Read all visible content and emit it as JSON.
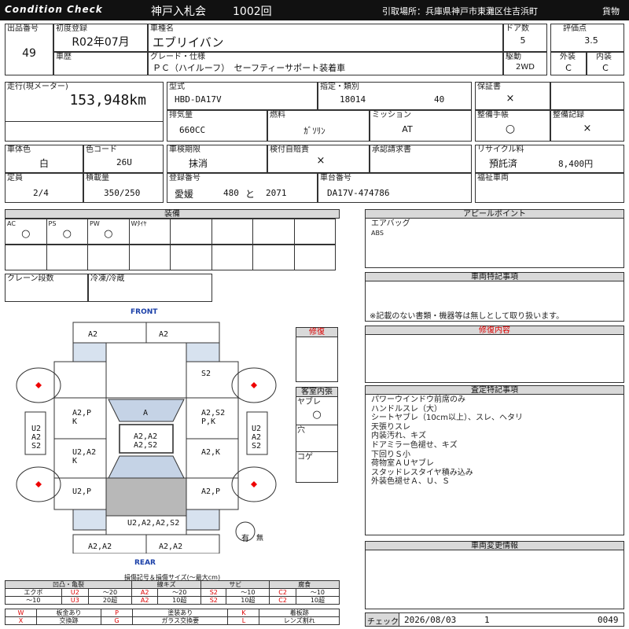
{
  "header": {
    "left_title": "Condition Check",
    "auction": "神戸入札会",
    "lot_round": "1002回",
    "pickup": "引取場所：兵庫県神戸市東灘区住吉浜町",
    "category": "貨物"
  },
  "row1": {
    "lot_label": "出品番号",
    "lot_value": "49",
    "first_reg_label": "初度登録",
    "first_reg_value": "R02年07月",
    "car_name_label": "車種名",
    "car_name_value": "エブリイバン",
    "doors_label": "ドア数",
    "doors_value": "5",
    "score_label": "評価点",
    "score_value": "3.5",
    "history_label": "車歴",
    "grade_label": "グレード・仕様",
    "grade_value": "ＰＣ（ハイルーフ）　セーフティーサポート装着車",
    "drive_label": "駆動",
    "drive_value": "2WD",
    "ext_label": "外装",
    "ext_value": "C",
    "int_label": "内装",
    "int_value": "C"
  },
  "row2": {
    "mileage_label": "走行(現メーター)",
    "mileage_value": "153,948km",
    "model_label": "型式",
    "model_value": "HBD-DA17V",
    "designation_label": "指定・類別",
    "designation_value": "18014",
    "class_value": "40",
    "warranty_label": "保証書",
    "warranty_value": "×",
    "disp_label": "排気量",
    "disp_value": "660CC",
    "fuel_label": "燃料",
    "fuel_value": "ｶﾞｿﾘﾝ",
    "mission_label": "ミッション",
    "mission_value": "AT",
    "manual_label": "整備手帳",
    "manual_value": "○",
    "record_label": "整備記録",
    "record_value": "×"
  },
  "row3": {
    "color_label": "車体色",
    "color_value": "白",
    "colorcode_label": "色コード",
    "colorcode_value": "26U",
    "inspection_label": "車検期限",
    "inspection_value": "抹消",
    "selfcheck_label": "検付自賠責",
    "selfcheck_value": "×",
    "approval_label": "承認請求書",
    "recycle_label": "リサイクル料",
    "recycle_status": "預託済",
    "recycle_value": "8,400円",
    "capacity_label": "定員",
    "capacity_value": "2/4",
    "load_label": "積載量",
    "load_value": "350/250",
    "plate_label": "登録番号",
    "plate_pref": "愛媛",
    "plate_class": "480",
    "plate_kana": "と",
    "plate_num": "2071",
    "chassis_label": "車台番号",
    "chassis_value": "DA17V-474786",
    "welfare_label": "福祉車両"
  },
  "equipment": {
    "title": "装備",
    "cells": [
      {
        "label": "AC",
        "mark": "○"
      },
      {
        "label": "PS",
        "mark": "○"
      },
      {
        "label": "PW",
        "mark": "○"
      },
      {
        "label": "Wﾀｲﾔ",
        "mark": ""
      },
      {
        "label": "",
        "mark": ""
      },
      {
        "label": "",
        "mark": ""
      },
      {
        "label": "",
        "mark": ""
      },
      {
        "label": "",
        "mark": ""
      }
    ],
    "crane_label": "クレーン段数",
    "freezer_label": "冷凍/冷蔵"
  },
  "appeal": {
    "title": "アピールポイント",
    "line1": "エアバッグ",
    "line2": "ABS"
  },
  "special": {
    "title": "車両特記事項",
    "note": "※記載のない書類・機器等は無しとして取り扱います。"
  },
  "repair": {
    "title": "修復内容",
    "side_label": "修復"
  },
  "interior": {
    "title": "客室内張",
    "items": [
      {
        "label": "ヤブレ",
        "mark": "○"
      },
      {
        "label": "穴",
        "mark": ""
      },
      {
        "label": "コゲ",
        "mark": ""
      }
    ]
  },
  "inspection_notes": {
    "title": "査定特記事項",
    "lines": [
      "パワーウインドウ前席のみ",
      "ハンドルスレ（大）",
      "シートヤブレ（10cm以上）、スレ、ヘタリ",
      "天張りスレ",
      "内装汚れ、キズ",
      "ドアミラー色褪せ、キズ",
      "下回りＳ小",
      "荷物室ＡＵヤブレ",
      "スタッドレスタイヤ積み込み",
      "外装色褪せＡ、Ｕ、Ｓ"
    ]
  },
  "change_info": {
    "title": "車両変更情報"
  },
  "diagram": {
    "front": "FRONT",
    "rear": "REAR",
    "front_bumper_left": "A2",
    "front_bumper_right": "A2",
    "right_front_fender": "S2",
    "left_front_door": "A2,P\nK",
    "hood_windshield": "A",
    "right_front_door": "A2,S2\nP,K",
    "left_side": "U2\nA2\nS2",
    "right_side": "U2\nA2\nS2",
    "roof": "A2,A2\nA2,S2",
    "left_rear_door": "U2,A2\nK",
    "right_rear_door": "A2,K",
    "left_quarter": "U2,P",
    "right_quarter": "A2,P",
    "rear_gate": "U2,A2,A2,S2",
    "rear_bumper_left": "A2,A2",
    "rear_bumper_right": "A2,A2",
    "spare": "有",
    "spare_none": "無"
  },
  "legend": {
    "title": "損傷記号＆損傷サイズ(〜最大cm)",
    "groups": [
      "凹凸・亀裂",
      "線キズ",
      "サビ",
      "腐食"
    ],
    "row1": [
      "エクボ",
      "U2",
      "〜20",
      "A2",
      "〜20",
      "S2",
      "〜10",
      "C2",
      "〜10"
    ],
    "row2": [
      "〜10",
      "U3",
      "20超",
      "A2",
      "10超",
      "S2",
      "10超",
      "C2",
      "10超"
    ],
    "row3": [
      "W",
      "板金あり",
      "P",
      "塗装あり",
      "K",
      "着板跡"
    ],
    "row4": [
      "X",
      "交換跡",
      "G",
      "ガラス交換要",
      "L",
      "レンズ割れ"
    ]
  },
  "footer": {
    "check_label": "チェック",
    "date": "2026/08/03",
    "inspector": "1",
    "number": "0049"
  }
}
